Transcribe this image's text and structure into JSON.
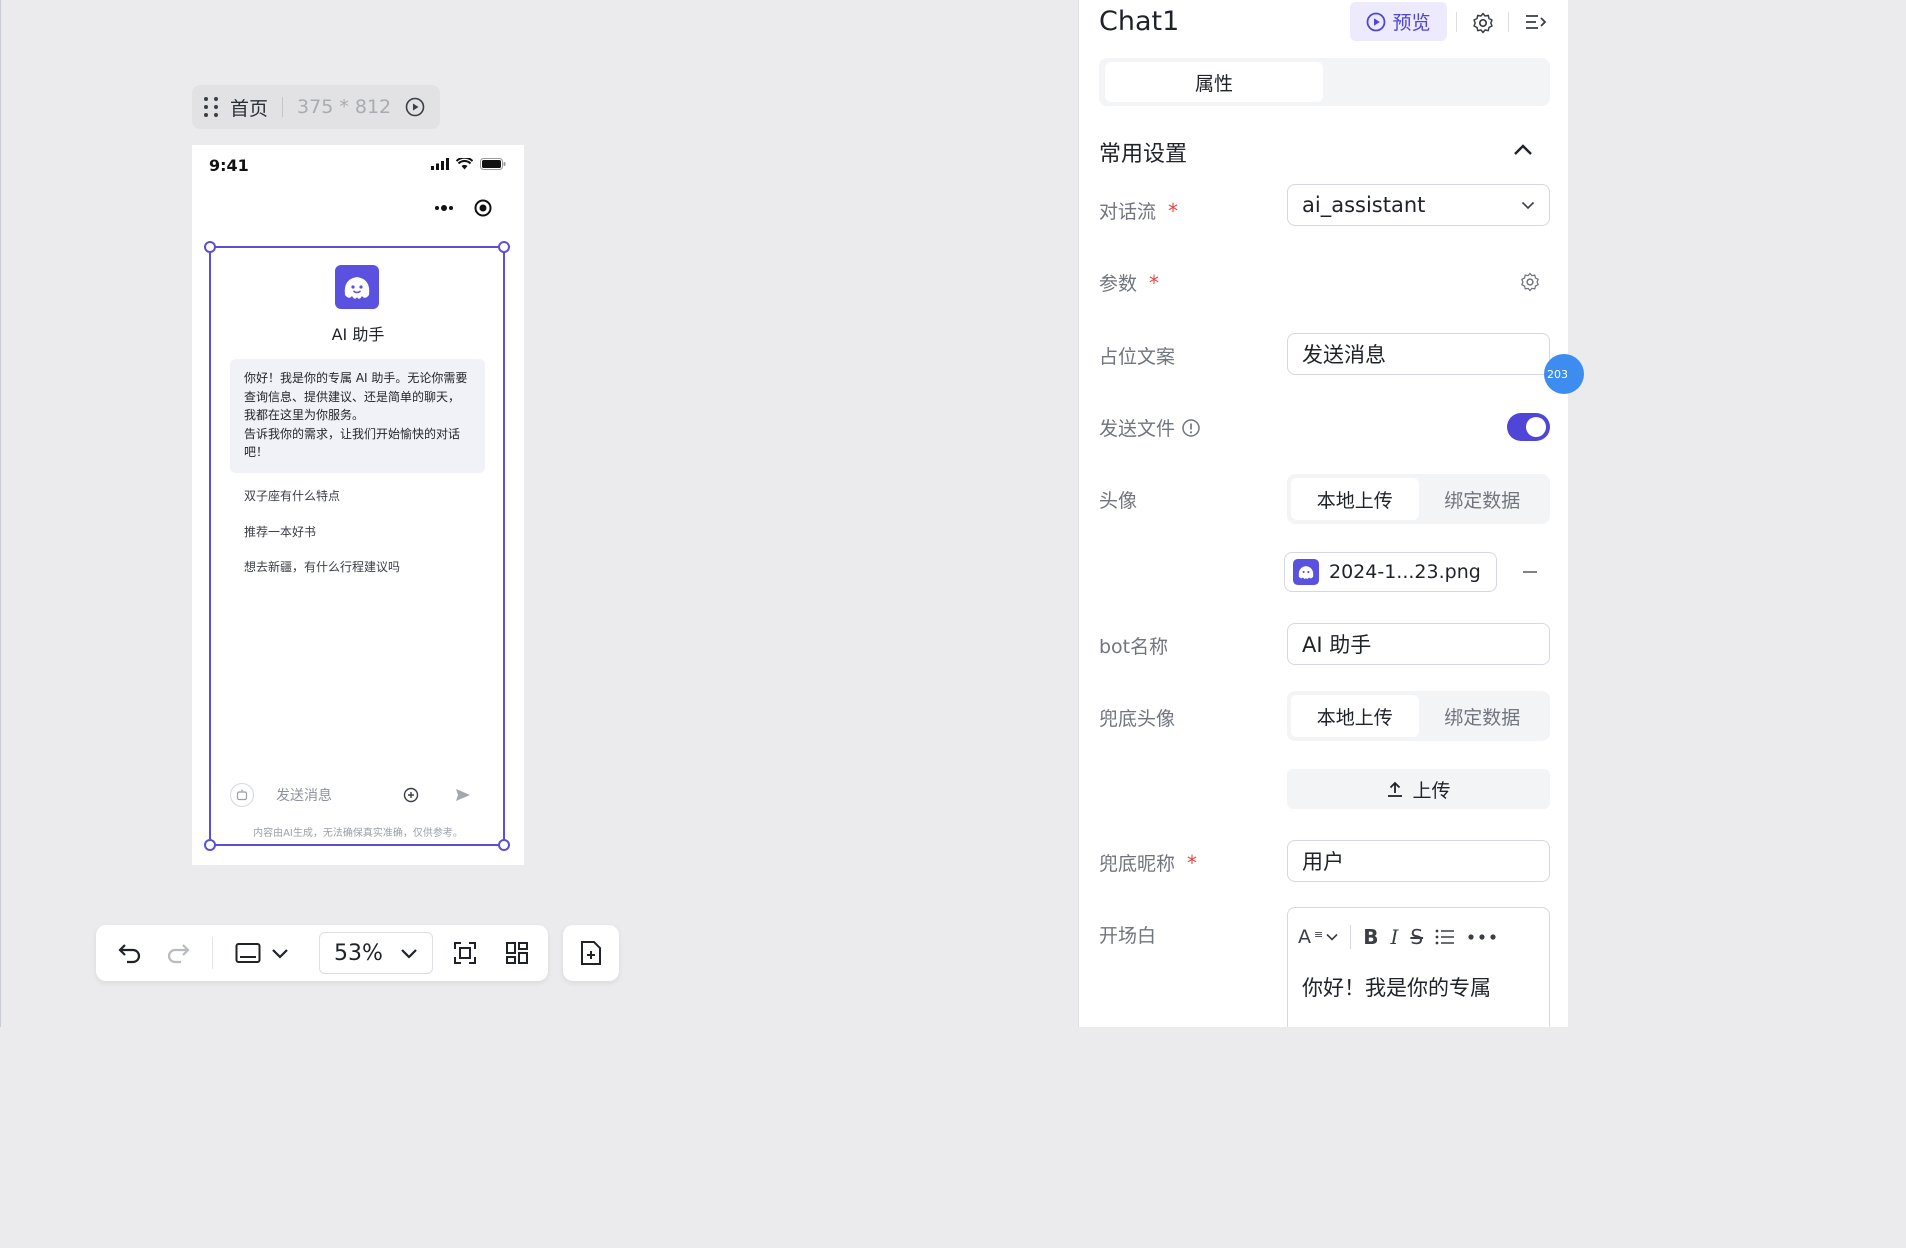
{
  "canvas": {
    "page_label": "首页",
    "page_size": "375 * 812"
  },
  "phone": {
    "status_time": "9:41",
    "bot_name": "AI 助手",
    "greeting": "你好！我是你的专属 AI 助手。无论你需要查询信息、提供建议、还是简单的聊天，我都在这里为你服务。\n告诉我你的需求，让我们开始愉快的对话吧！",
    "suggestions": [
      "双子座有什么特点",
      "推荐一本好书",
      "想去新疆，有什么行程建议吗"
    ],
    "input_placeholder": "发送消息",
    "disclaimer": "内容由AI生成，无法确保真实准确，仅供参考。"
  },
  "toolbar": {
    "zoom": "53%"
  },
  "panel": {
    "title": "Chat1",
    "preview_label": "预览",
    "tab_label": "属性",
    "section_title": "常用设置",
    "flow_label": "对话流",
    "flow_value": "ai_assistant",
    "params_label": "参数",
    "placeholder_label": "占位文案",
    "placeholder_value": "发送消息",
    "send_file_label": "发送文件",
    "send_file_on": true,
    "avatar_label": "头像",
    "seg_local": "本地上传",
    "seg_bind": "绑定数据",
    "avatar_file": "2024-1...23.png",
    "bot_name_label": "bot名称",
    "bot_name_value": "AI 助手",
    "fallback_avatar_label": "兜底头像",
    "upload_label": "上传",
    "fallback_nick_label": "兜底昵称",
    "fallback_nick_value": "用户",
    "opening_label": "开场白",
    "opening_value": "你好！我是你的专属",
    "side_badge": "203",
    "accent_color": "#4f45d6",
    "required_color": "#e54545"
  }
}
